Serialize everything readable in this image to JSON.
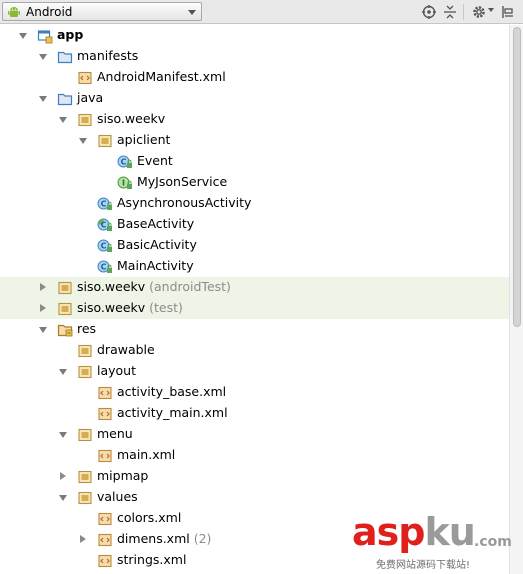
{
  "toolbar": {
    "view_label": "Android",
    "buttons": [
      "sync-target-icon",
      "collapse-all-icon",
      "gear-icon",
      "pin-icon"
    ]
  },
  "tree": [
    {
      "label": "app",
      "bold": true,
      "indent": 0,
      "arrow": "down",
      "icon": "module-icon"
    },
    {
      "label": "manifests",
      "indent": 1,
      "arrow": "down",
      "icon": "folder-icon"
    },
    {
      "label": "AndroidManifest.xml",
      "indent": 2,
      "arrow": "",
      "icon": "xml-file-icon"
    },
    {
      "label": "java",
      "indent": 1,
      "arrow": "down",
      "icon": "folder-icon"
    },
    {
      "label": "siso.weekv",
      "indent": 2,
      "arrow": "down",
      "icon": "package-icon"
    },
    {
      "label": "apiclient",
      "indent": 3,
      "arrow": "down",
      "icon": "package-icon"
    },
    {
      "label": "Event",
      "indent": 4,
      "arrow": "",
      "icon": "class-icon"
    },
    {
      "label": "MyJsonService",
      "indent": 4,
      "arrow": "",
      "icon": "interface-icon"
    },
    {
      "label": "AsynchronousActivity",
      "indent": 3,
      "arrow": "",
      "icon": "class-icon"
    },
    {
      "label": "BaseActivity",
      "indent": 3,
      "arrow": "",
      "icon": "abstract-class-icon"
    },
    {
      "label": "BasicActivity",
      "indent": 3,
      "arrow": "",
      "icon": "class-icon"
    },
    {
      "label": "MainActivity",
      "indent": 3,
      "arrow": "",
      "icon": "class-icon"
    },
    {
      "label": "siso.weekv",
      "suffix": " (androidTest)",
      "indent": 1,
      "arrow": "right",
      "icon": "package-icon",
      "highlight": true
    },
    {
      "label": "siso.weekv",
      "suffix": " (test)",
      "indent": 1,
      "arrow": "right",
      "icon": "package-icon",
      "highlight": true
    },
    {
      "label": "res",
      "indent": 1,
      "arrow": "down",
      "icon": "res-folder-icon"
    },
    {
      "label": "drawable",
      "indent": 2,
      "arrow": "",
      "icon": "package-icon"
    },
    {
      "label": "layout",
      "indent": 2,
      "arrow": "down",
      "icon": "package-icon"
    },
    {
      "label": "activity_base.xml",
      "indent": 3,
      "arrow": "",
      "icon": "xml-file-icon"
    },
    {
      "label": "activity_main.xml",
      "indent": 3,
      "arrow": "",
      "icon": "xml-file-icon"
    },
    {
      "label": "menu",
      "indent": 2,
      "arrow": "down",
      "icon": "package-icon"
    },
    {
      "label": "main.xml",
      "indent": 3,
      "arrow": "",
      "icon": "xml-file-icon"
    },
    {
      "label": "mipmap",
      "indent": 2,
      "arrow": "right",
      "icon": "package-icon"
    },
    {
      "label": "values",
      "indent": 2,
      "arrow": "down",
      "icon": "package-icon"
    },
    {
      "label": "colors.xml",
      "indent": 3,
      "arrow": "",
      "icon": "xml-file-icon"
    },
    {
      "label": "dimens.xml",
      "suffix": " (2)",
      "indent": 3,
      "arrow": "right",
      "icon": "xml-file-icon"
    },
    {
      "label": "strings.xml",
      "indent": 3,
      "arrow": "",
      "icon": "xml-file-icon"
    }
  ],
  "watermark": {
    "asp": "asp",
    "ku": "ku",
    "com": ".com",
    "subtitle": "免费网站源码下载站!"
  }
}
